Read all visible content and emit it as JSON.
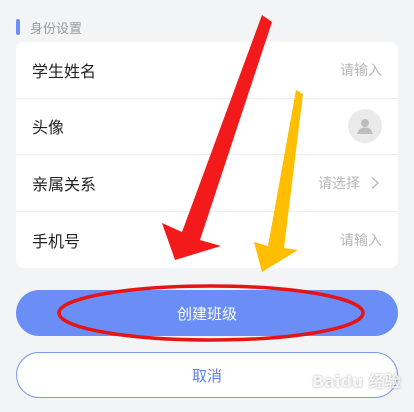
{
  "section": {
    "title": "身份设置"
  },
  "form": {
    "rows": [
      {
        "label": "学生姓名",
        "value": "请输入"
      },
      {
        "label": "头像"
      },
      {
        "label": "亲属关系",
        "value": "请选择"
      },
      {
        "label": "手机号",
        "value": "请输入"
      }
    ]
  },
  "actions": {
    "create_label": "创建班级",
    "cancel_label": "取消"
  },
  "watermark": {
    "text": "Baidu 经验"
  },
  "colors": {
    "accent": "#6a8ef6",
    "arrow_red": "#f21a1a",
    "arrow_yellow": "#ffbe00"
  }
}
